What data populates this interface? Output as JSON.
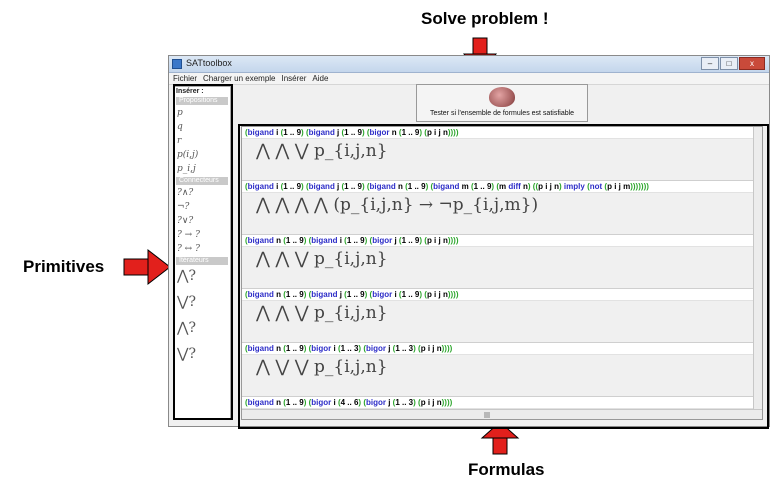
{
  "callouts": {
    "solve": "Solve problem !",
    "primitives": "Primitives",
    "formulas": "Formulas"
  },
  "colors": {
    "arrow": "#e2201c",
    "keyword": "#2d2dc8",
    "bracket": "#2ba52b"
  },
  "window": {
    "title": "SATtoolbox",
    "buttons": {
      "minimize": "–",
      "maximize": "□",
      "close": "x"
    },
    "menu": [
      "Fichier",
      "Charger un exemple",
      "Insérer",
      "Aide"
    ]
  },
  "sidebar": {
    "header": "Insérer :",
    "sections": [
      "Propositions",
      "Connecteurs",
      "Itérateurs"
    ],
    "propositions": [
      "p",
      "q",
      "r",
      "p(i,j)",
      "p_i,j"
    ],
    "connectors": [
      "?∧?",
      "¬?",
      "?∨?",
      "? → ?",
      "? ↔ ?"
    ],
    "iterators": [
      "⋀?",
      "⋁?",
      "⋀?",
      "⋁?"
    ]
  },
  "solve_button": {
    "label": "Tester si l'ensemble de formules est satisfiable",
    "icon": "brain-icon"
  },
  "formulas": [
    {
      "text": "(bigand i (1 .. 9) (bigand j (1 .. 9) (bigor n (1 .. 9) (p i j n))))",
      "render": "⋀ ⋀ ⋁ p_{i,j,n}"
    },
    {
      "text": "(bigand i (1 .. 9) (bigand j (1 .. 9) (bigand n (1 .. 9) (bigand m (1 .. 9) (m diff n) ((p i j n) imply (not (p i j m)))))))",
      "render": "⋀ ⋀ ⋀ ⋀ (p_{i,j,n} → ¬p_{i,j,m})"
    },
    {
      "text": "(bigand n (1 .. 9) (bigand i (1 .. 9) (bigor j (1 .. 9) (p i j n))))",
      "render": "⋀ ⋀ ⋁ p_{i,j,n}"
    },
    {
      "text": "(bigand n (1 .. 9) (bigand j (1 .. 9) (bigor i (1 .. 9) (p i j n))))",
      "render": "⋀ ⋀ ⋁ p_{i,j,n}"
    },
    {
      "text": "(bigand n (1 .. 9) (bigor i (1 .. 3) (bigor j (1 .. 3) (p i j n))))",
      "render": "⋀ ⋁ ⋁ p_{i,j,n}"
    },
    {
      "text": "(bigand n (1 .. 9) (bigor i (4 .. 6) (bigor j (1 .. 3) (p i j n))))",
      "render": ""
    }
  ]
}
